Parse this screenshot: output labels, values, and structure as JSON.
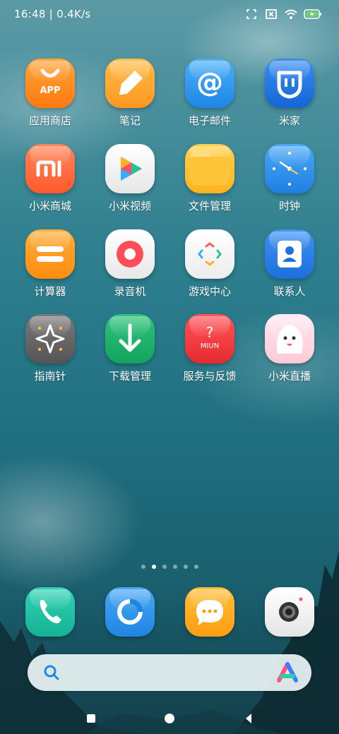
{
  "status_bar": {
    "time_speed": "16:48 | 0.4K/s"
  },
  "apps": [
    {
      "label": "应用商店",
      "icon": "app-store-icon",
      "badge_text": "APP",
      "color": "#ff8a1d"
    },
    {
      "label": "笔记",
      "icon": "notes-icon",
      "color": "#ffa630"
    },
    {
      "label": "电子邮件",
      "icon": "email-icon",
      "color": "#2f9cf0"
    },
    {
      "label": "米家",
      "icon": "mijia-icon",
      "color": "#1f7ae0"
    },
    {
      "label": "小米商城",
      "icon": "mi-store-icon",
      "badge_text": "mi",
      "color": "#ff6a3d"
    },
    {
      "label": "小米视频",
      "icon": "mi-video-icon",
      "color": "#f3f3f3"
    },
    {
      "label": "文件管理",
      "icon": "file-manager-icon",
      "color": "#ffc23d"
    },
    {
      "label": "时钟",
      "icon": "clock-icon",
      "color": "#2f93ea"
    },
    {
      "label": "计算器",
      "icon": "calculator-icon",
      "color": "#ff9a1f"
    },
    {
      "label": "录音机",
      "icon": "recorder-icon",
      "color": "#f4f4f4"
    },
    {
      "label": "游戏中心",
      "icon": "game-center-icon",
      "color": "#f4f4f4"
    },
    {
      "label": "联系人",
      "icon": "contacts-icon",
      "color": "#2a7de6"
    },
    {
      "label": "指南针",
      "icon": "compass-icon",
      "color": "#666666"
    },
    {
      "label": "下载管理",
      "icon": "download-icon",
      "color": "#1fb36a"
    },
    {
      "label": "服务与反馈",
      "icon": "service-feedback-icon",
      "badge_text": "MIUN",
      "color": "#f0383c"
    },
    {
      "label": "小米直播",
      "icon": "mi-live-icon",
      "color": "#ffe0e8"
    }
  ],
  "page_indicator": {
    "count": 6,
    "active_index": 1
  },
  "dock": [
    {
      "icon": "phone-icon",
      "color": "#1fbfa6"
    },
    {
      "icon": "browser-icon",
      "color": "#2f95ea"
    },
    {
      "icon": "messages-icon",
      "color": "#ffad1f"
    },
    {
      "icon": "camera-icon",
      "color": "#f2f2f2"
    }
  ],
  "search": {
    "value": "",
    "icon": "search-icon",
    "assistant_icon": "assistant-icon"
  },
  "navigation": {
    "recents": "recents-icon",
    "home": "home-icon",
    "back": "back-icon"
  }
}
